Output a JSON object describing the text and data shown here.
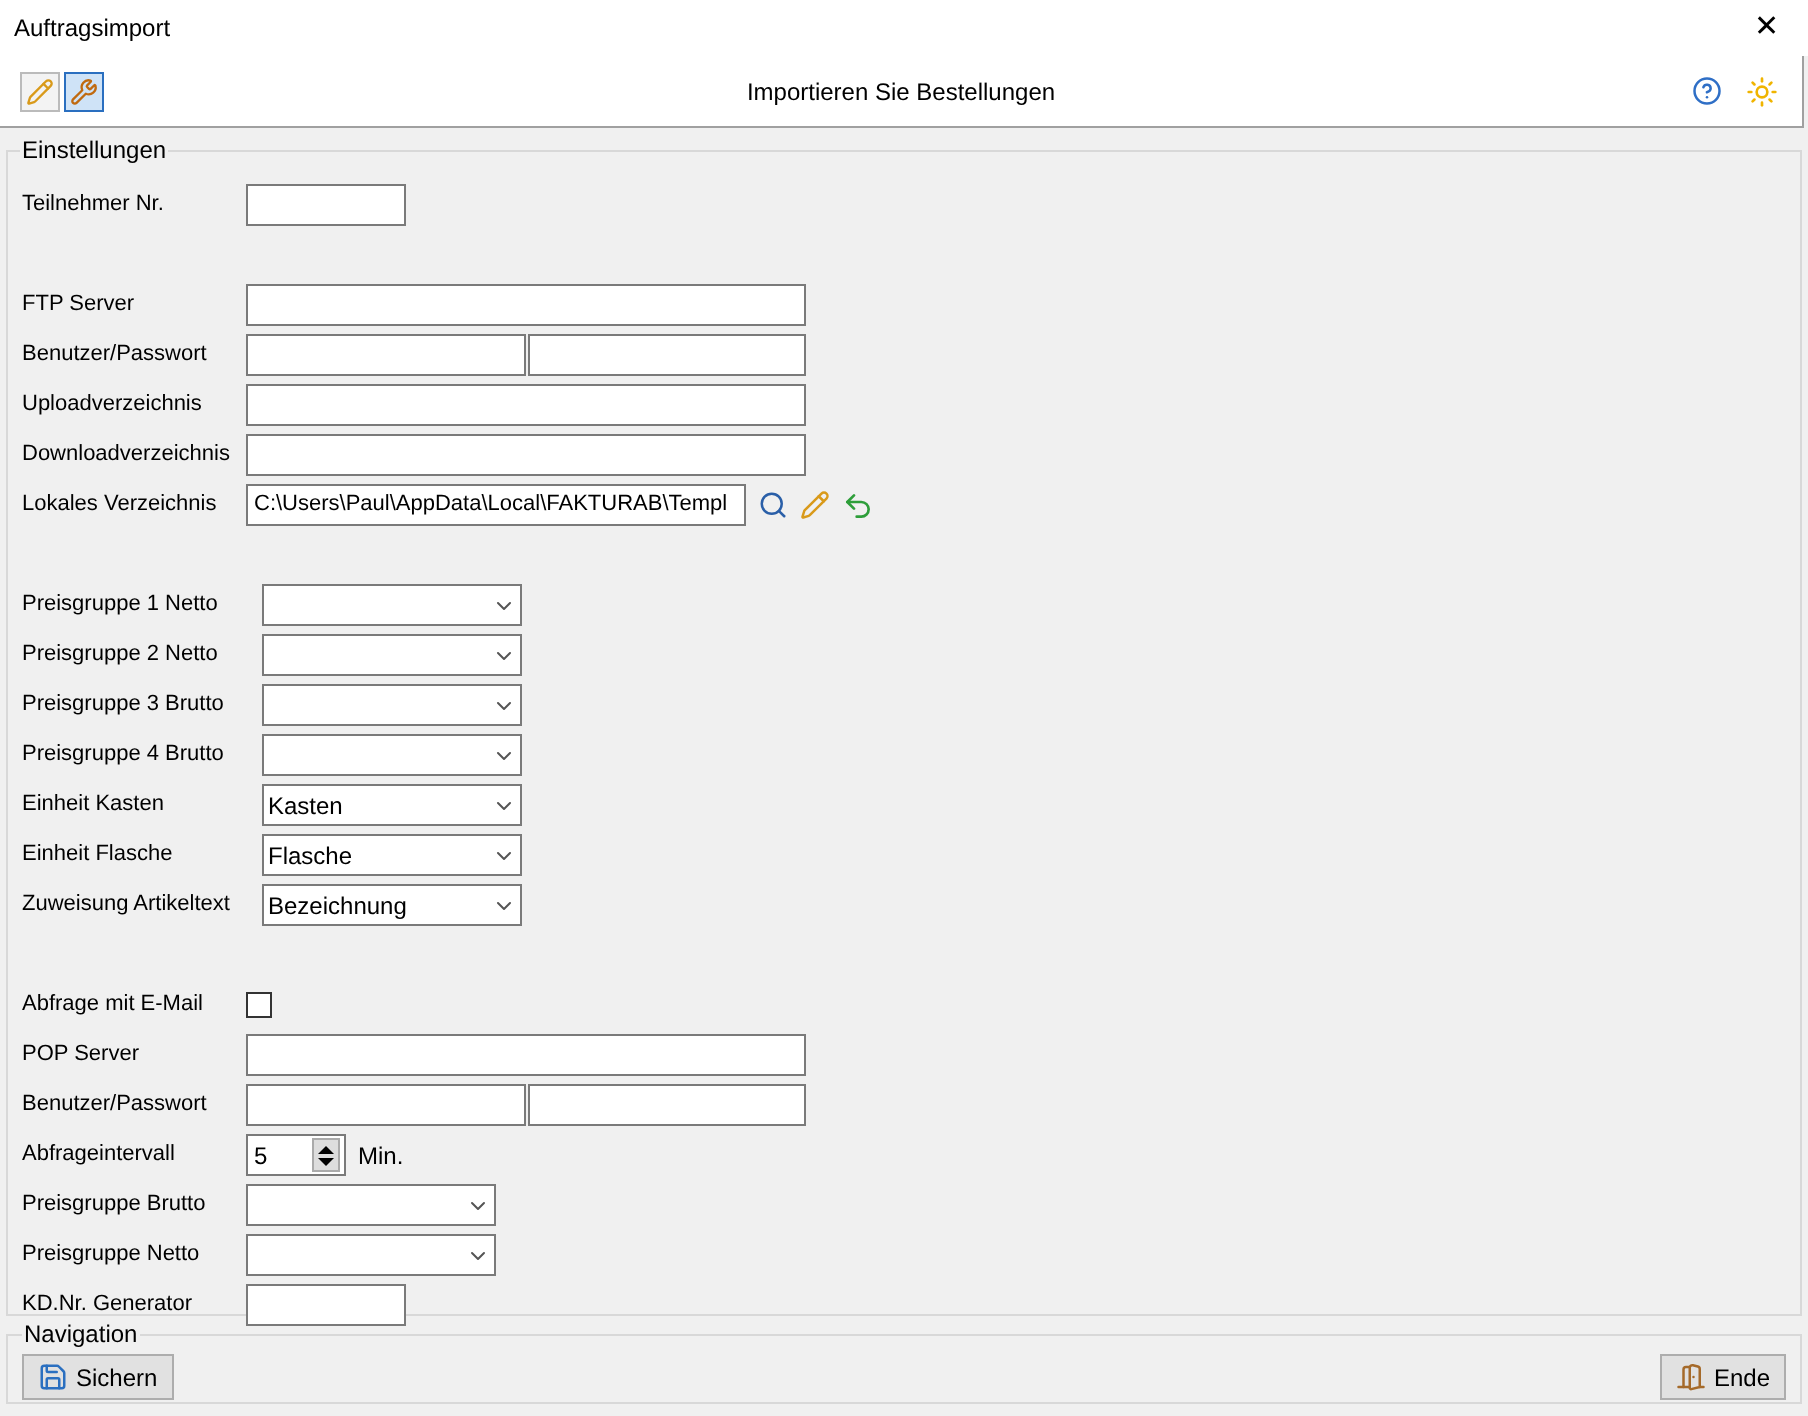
{
  "window": {
    "title": "Auftragsimport",
    "close": "✕"
  },
  "toolbar": {
    "title": "Importieren Sie Bestellungen",
    "tools": [
      {
        "selected": false
      },
      {
        "selected": true
      }
    ]
  },
  "settings": {
    "legend": "Einstellungen",
    "sections": [
      [
        {
          "kind": "short_field",
          "label": "Teilnehmer Nr."
        }
      ],
      [
        {
          "kind": "field",
          "label": "FTP Server"
        },
        {
          "kind": "field_pair",
          "label": "Benutzer/Passwort"
        },
        {
          "kind": "field",
          "label": "Uploadverzeichnis"
        },
        {
          "kind": "field",
          "label": "Downloadverzeichnis"
        },
        {
          "kind": "path_field",
          "label": "Lokales Verzeichnis",
          "value": "C:\\Users\\Paul\\AppData\\Local\\FAKTURAB\\Templ"
        }
      ],
      [
        {
          "kind": "dropdown",
          "label": "Preisgruppe 1 Netto"
        },
        {
          "kind": "dropdown",
          "label": "Preisgruppe 2 Netto"
        },
        {
          "kind": "dropdown",
          "label": "Preisgruppe 3 Brutto"
        },
        {
          "kind": "dropdown",
          "label": "Preisgruppe 4 Brutto"
        },
        {
          "kind": "dropdown",
          "label": "Einheit Kasten",
          "value": "Kasten"
        },
        {
          "kind": "dropdown",
          "label": "Einheit Flasche",
          "value": "Flasche"
        },
        {
          "kind": "dropdown",
          "label": "Zuweisung Artikeltext",
          "value": "Bezeichnung"
        }
      ],
      [
        {
          "kind": "checkbox",
          "label": "Abfrage mit E-Mail",
          "checked": false
        },
        {
          "kind": "field",
          "label": "POP Server"
        },
        {
          "kind": "field_pair",
          "label": "Benutzer/Passwort"
        },
        {
          "kind": "spinner",
          "label": "Abfrageintervall",
          "value": "5",
          "unit": "Min."
        },
        {
          "kind": "small_dropdown",
          "label": "Preisgruppe Brutto"
        },
        {
          "kind": "small_dropdown",
          "label": "Preisgruppe Netto"
        },
        {
          "kind": "short_field",
          "label": "KD.Nr. Generator"
        }
      ]
    ]
  },
  "navigation": {
    "legend": "Navigation",
    "buttons": [
      {
        "kind": "save",
        "label": "Sichern"
      },
      {
        "kind": "exit",
        "label": "Ende"
      }
    ]
  }
}
